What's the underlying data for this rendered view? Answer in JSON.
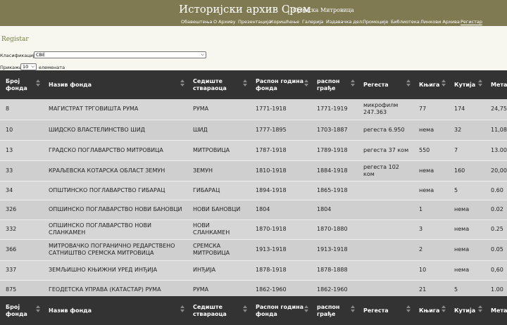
{
  "site": {
    "title": "Историјски архив Срем",
    "separator": "|",
    "subtitle": "Сремска Митровица"
  },
  "nav": [
    {
      "label": "Обавештења"
    },
    {
      "label": "О Архиву"
    },
    {
      "label": "Презентација"
    },
    {
      "label": "Коришћење"
    },
    {
      "label": "Галерија"
    },
    {
      "label": "Издавачка дел."
    },
    {
      "label": "Промоције"
    },
    {
      "label": "Библиотека"
    },
    {
      "label": "Линкови Архива"
    },
    {
      "label": "Регистар",
      "active": true
    }
  ],
  "page": {
    "heading": "Registar",
    "classification_label": "Класификација",
    "classification_value": "СВЕ",
    "show_label": "Прикажи",
    "show_value": "10",
    "entries_label": "елемената"
  },
  "table": {
    "columns": [
      "Број фонда",
      "Назив фонда",
      "Седиште ствараоца",
      "Распон година фонда",
      "распон грађе",
      "Регеста",
      "Књига",
      "Кутија",
      "Метара"
    ],
    "rows": [
      [
        "8",
        "МАГИСТРАТ ТРГОВИШТА РУМА",
        "РУМА",
        "1771-1918",
        "1771-1919",
        "микрофилм 247.363",
        "77",
        "174",
        "24,75"
      ],
      [
        "10",
        "ШИДСКО ВЛАСТЕЛИНСТВО ШИД",
        "ШИД",
        "1777-1895",
        "1703-1887",
        "регеста 6.950",
        "нема",
        "32",
        "11,08"
      ],
      [
        "13",
        "ГРАДСКО ПОГЛАВАРСТВО МИТРОВИЦА",
        "МИТРОВИЦА",
        "1787-1918",
        "1789-1918",
        "регеста 37 ком",
        "550",
        "7",
        "13.00"
      ],
      [
        "33",
        "КРАЉЕВСКА КОТАРСКА ОБЛАСТ ЗЕМУН",
        "ЗЕМУН",
        "1810-1918",
        "1884-1918",
        "регеста 102 ком",
        "нема",
        "160",
        "20,00"
      ],
      [
        "34",
        "ОПШТИНСКО ПОГЛАВАРСТВО ГИБАРАЦ",
        "ГИБАРАЦ",
        "1894-1918",
        "1865-1918",
        "",
        "нема",
        "5",
        "0.60"
      ],
      [
        "326",
        "ОПШИНСКО ПОГЛАВАРСТВО НОВИ БАНОВЦИ",
        "НОВИ БАНОВЦИ",
        "1804",
        "1804",
        "",
        "1",
        "нема",
        "0.02"
      ],
      [
        "332",
        "ОПШИНСКО ПОГЛАВАРСТВО НОВИ СЛАНКАМЕН",
        "НОВИ СЛАНКАМЕН",
        "1870-1918",
        "1870-1880",
        "",
        "3",
        "нема",
        "0.25"
      ],
      [
        "366",
        "МИТРОВАЧКО ПОГРАНИЧНО РЕДАРСТВЕНО САТНИШТВО СРЕМСКА МИТРОВИЦА",
        "СРЕМСКА МИТРОВИЦА",
        "1913-1918",
        "1913-1918",
        "",
        "2",
        "нема",
        "0.05"
      ],
      [
        "337",
        "ЗЕМЉИШНО КЊИЖНИ УРЕД ИНЂИЈА",
        "ИНЂИЈА",
        "1878-1918",
        "1878-1888",
        "",
        "10",
        "нема",
        "0,60"
      ],
      [
        "875",
        "ГЕОДЕТСКА УПРАВА (КАТАСТАР) РУМА",
        "РУМА",
        "1862-1960",
        "1862-1960",
        "",
        "21",
        "5",
        "1.00"
      ]
    ]
  }
}
